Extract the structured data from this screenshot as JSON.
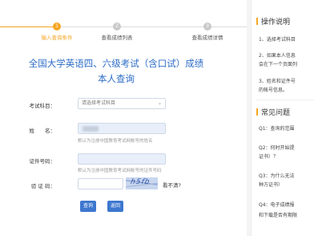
{
  "steps": [
    {
      "num": "1",
      "label": "输入查询条件",
      "active": true
    },
    {
      "num": "2",
      "label": "查看成绩列表",
      "active": false
    },
    {
      "num": "3",
      "label": "查看成绩详情",
      "active": false
    }
  ],
  "title_line1": "全国大学英语四、六级考试（含口试）成绩",
  "title_line2": "本人查询",
  "form": {
    "subject_label": "考试科目：",
    "subject_placeholder": "请选择考试科目",
    "name_label": "姓　　名：",
    "name_hint": "默认为注册中国教育考试网帐号的姓名",
    "id_label": "证件号码：",
    "id_hint": "默认为注册中国教育考试网帐号的证件号码",
    "captcha_label": "验 证 码：",
    "captcha_text": "h5fb",
    "cant_see": "看不清?",
    "query_button": "查询",
    "back_button": "返回"
  },
  "sidebar": {
    "ops_title": "操作说明",
    "ops_items": [
      "1、选择考试科目",
      "2、如果本人信息",
      "会在下一个页面列",
      "3、姓名和证件号",
      "的帐号信息。"
    ],
    "faq_title": "常见问题",
    "faq_items": [
      "Q1：查询的范围",
      "Q2：何时开始提",
      "证书）？",
      "Q3：为什么无法",
      "种方证书）",
      "Q4：电子成绩报",
      "和下载是否有期限"
    ]
  },
  "colors": {
    "accent": "#f5a623",
    "primary": "#2d6dc7",
    "button": "#3d77cf"
  }
}
